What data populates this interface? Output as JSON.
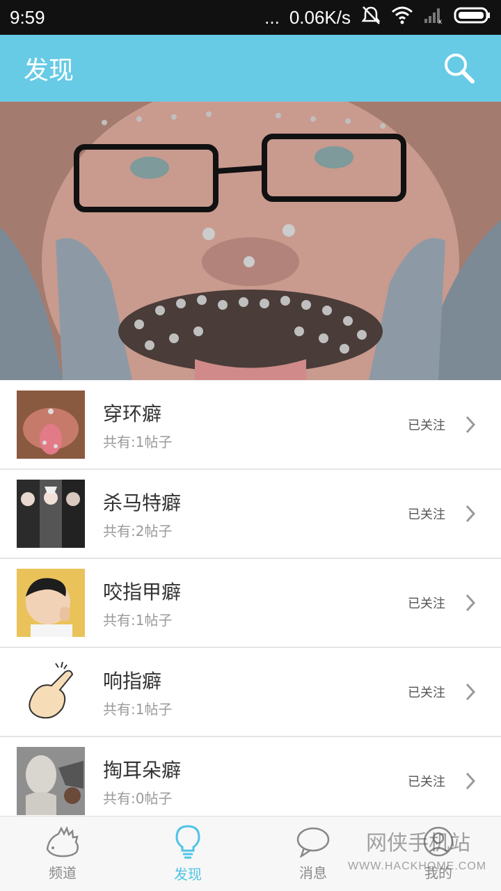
{
  "status_bar": {
    "time": "9:59",
    "dots": "...",
    "speed": "0.06K/s"
  },
  "app_bar": {
    "title": "发现"
  },
  "list": [
    {
      "title": "穿环癖",
      "sub": "共有:1帖子",
      "status": "已关注"
    },
    {
      "title": "杀马特癖",
      "sub": "共有:2帖子",
      "status": "已关注"
    },
    {
      "title": "咬指甲癖",
      "sub": "共有:1帖子",
      "status": "已关注"
    },
    {
      "title": "响指癖",
      "sub": "共有:1帖子",
      "status": "已关注"
    },
    {
      "title": "掏耳朵癖",
      "sub": "共有:0帖子",
      "status": "已关注"
    }
  ],
  "tabs": [
    {
      "label": "频道",
      "icon": "hedgehog-icon"
    },
    {
      "label": "发现",
      "icon": "lightbulb-icon"
    },
    {
      "label": "消息",
      "icon": "chat-bubble-icon"
    },
    {
      "label": "我的",
      "icon": "person-icon"
    }
  ],
  "watermark": {
    "cn": "网侠手机站",
    "en": "WWW.HACKHOME.COM"
  },
  "colors": {
    "accent": "#67cbe6",
    "tab_active": "#4fc3e6"
  }
}
